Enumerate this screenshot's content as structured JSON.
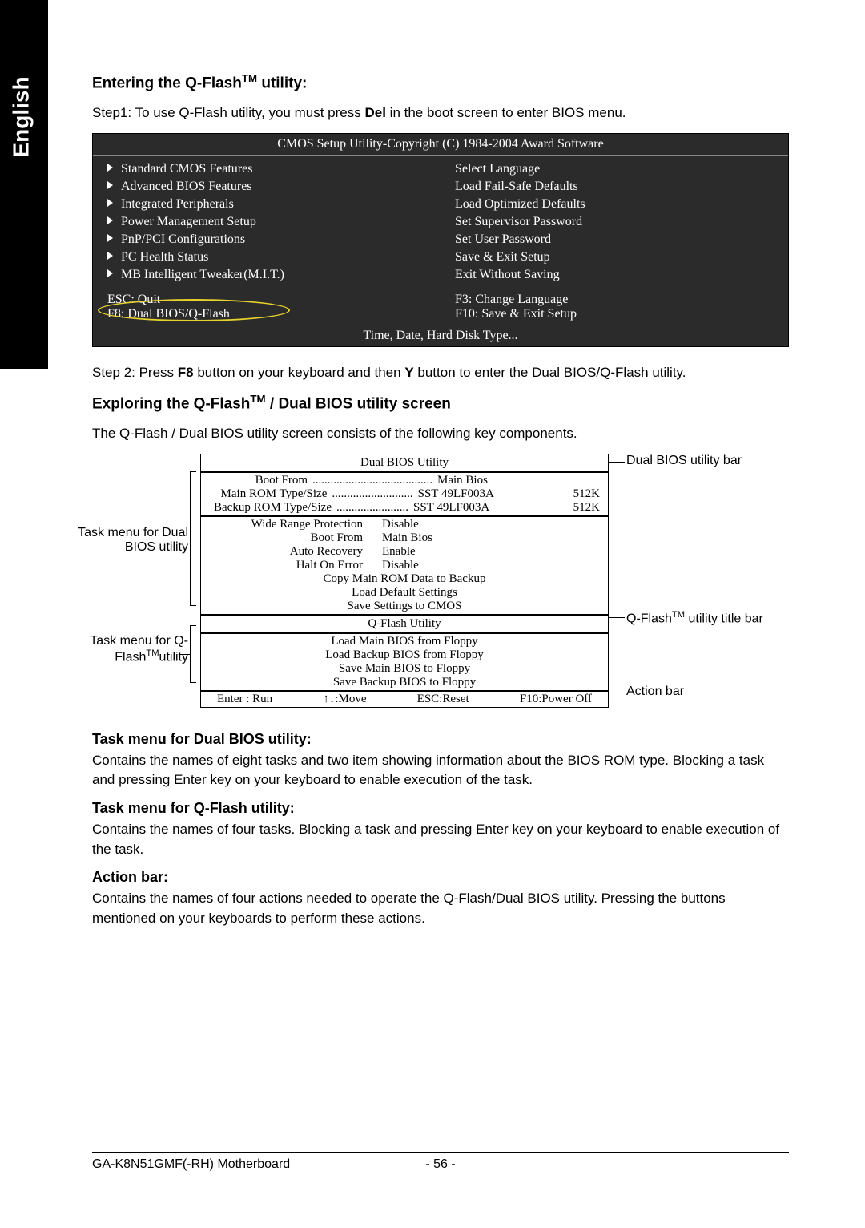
{
  "sidebar": {
    "label": "English"
  },
  "section1": {
    "heading_pre": "Entering the Q-Flash",
    "heading_tm": "TM",
    "heading_post": " utility:",
    "step1_a": "Step1: To use Q-Flash utility, you must press ",
    "step1_b": "Del",
    "step1_c": " in the boot screen to enter BIOS menu."
  },
  "bios": {
    "title": "CMOS Setup Utility-Copyright (C) 1984-2004 Award Software",
    "left": [
      "Standard CMOS Features",
      "Advanced BIOS Features",
      "Integrated Peripherals",
      "Power Management Setup",
      "PnP/PCI Configurations",
      "PC Health Status",
      "MB Intelligent Tweaker(M.I.T.)"
    ],
    "right": [
      "Select Language",
      "Load Fail-Safe Defaults",
      "Load Optimized Defaults",
      "Set Supervisor Password",
      "Set User Password",
      "Save & Exit Setup",
      "Exit Without Saving"
    ],
    "foot_l1": "ESC: Quit",
    "foot_l2": "F8: Dual BIOS/Q-Flash",
    "foot_r1": "F3: Change Language",
    "foot_r2": "F10: Save & Exit Setup",
    "status": "Time, Date, Hard Disk Type..."
  },
  "step2": {
    "a": "Step 2: Press ",
    "b": "F8",
    "c": " button on your keyboard and then ",
    "d": "Y",
    "e": " button to enter the Dual BIOS/Q-Flash utility."
  },
  "section2": {
    "heading_pre": "Exploring the Q-Flash",
    "heading_tm": "TM",
    "heading_post": " / Dual BIOS utility screen",
    "intro": "The Q-Flash / Dual BIOS utility screen consists of the following key components."
  },
  "util": {
    "dual_title": "Dual BIOS Utility",
    "boot_from_k": "Boot From",
    "boot_from_v": "Main Bios",
    "main_rom_k": "Main ROM Type/Size",
    "main_rom_v": "SST 49LF003A",
    "main_rom_s": "512K",
    "bak_rom_k": "Backup ROM Type/Size",
    "bak_rom_v": "SST 49LF003A",
    "bak_rom_s": "512K",
    "tasks1": [
      {
        "k": "Wide Range Protection",
        "v": "Disable"
      },
      {
        "k": "Boot From",
        "v": "Main Bios"
      },
      {
        "k": "Auto Recovery",
        "v": "Enable"
      },
      {
        "k": "Halt On Error",
        "v": "Disable"
      }
    ],
    "tasks1b": [
      "Copy Main ROM Data to Backup",
      "Load Default Settings",
      "Save Settings to CMOS"
    ],
    "qflash_title": "Q-Flash Utility",
    "tasks2": [
      "Load Main BIOS from Floppy",
      "Load Backup BIOS from Floppy",
      "Save Main BIOS to Floppy",
      "Save Backup BIOS to Floppy"
    ],
    "actions": {
      "a": "Enter : Run",
      "b": "↑↓:Move",
      "c": "ESC:Reset",
      "d": "F10:Power Off"
    }
  },
  "callouts": {
    "left1": "Task menu for Dual BIOS utility",
    "left2_a": "Task menu for Q-Flash",
    "left2_tm": "TM",
    "left2_b": "utility",
    "right1": "Dual BIOS utility bar",
    "right2_a": "Q-Flash",
    "right2_tm": "TM",
    "right2_b": " utility title bar",
    "right3": "Action bar"
  },
  "desc": {
    "h1": "Task menu for Dual BIOS utility:",
    "p1": "Contains the names of eight tasks and two item showing information about the BIOS ROM type. Blocking a task and pressing Enter key on your keyboard to enable execution of the task.",
    "h2": "Task menu for Q-Flash utility:",
    "p2": "Contains the names of four tasks. Blocking a task and pressing Enter key on your keyboard to enable execution of the task.",
    "h3": "Action bar:",
    "p3": "Contains the names of four actions needed to operate the Q-Flash/Dual BIOS utility. Pressing the buttons mentioned on your keyboards to perform these actions."
  },
  "footer": {
    "product": "GA-K8N51GMF(-RH) Motherboard",
    "page": "- 56 -"
  }
}
